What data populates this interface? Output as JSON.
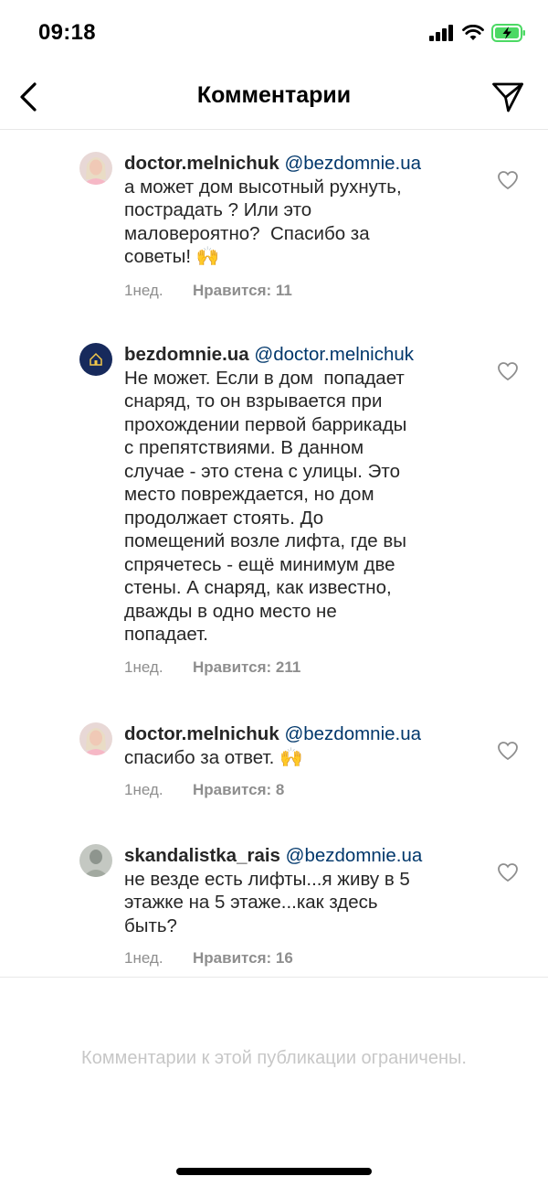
{
  "status_bar": {
    "time": "09:18"
  },
  "header": {
    "title": "Комментарии"
  },
  "comments": [
    {
      "username": "doctor.melnichuk",
      "mention": "@bezdomnie.ua",
      "text": "а может дом высотный рухнуть,\nпострадать ? Или это\nмаловероятно?  Спасибо за\nсоветы! 🙌",
      "time": "1нед.",
      "likes": "Нравится: 11",
      "avatar_icon": "woman-portrait-avatar"
    },
    {
      "username": "bezdomnie.ua",
      "mention": "@doctor.melnichuk",
      "text": "Не может. Если в дом  попадает\nснаряд, то он взрывается при\nпрохождении первой баррикады\nс препятствиями. В данном\nслучае - это стена с улицы. Это\nместо повреждается, но дом\nпродолжает стоять. До\nпомещений возле лифта, где вы\nспрячетесь - ещё минимум две\nстены. А снаряд, как известно,\nдважды в одно место не\nпопадает.",
      "time": "1нед.",
      "likes": "Нравится: 211",
      "avatar_icon": "bezdomnie-logo-avatar",
      "avatar_text": "bezdomnie.ua"
    },
    {
      "username": "doctor.melnichuk",
      "mention": "@bezdomnie.ua",
      "text": "спасибо за ответ. 🙌",
      "time": "1нед.",
      "likes": "Нравится: 8",
      "avatar_icon": "woman-portrait-avatar"
    },
    {
      "username": "skandalistka_rais",
      "mention": "@bezdomnie.ua",
      "text": "не везде есть лифты...я живу в 5\nэтажке на 5 этаже...как здесь\nбыть?",
      "time": "1нед.",
      "likes": "Нравится: 16",
      "avatar_icon": "person-photo-avatar"
    }
  ],
  "footer": {
    "restricted_notice": "Комментарии к этой публикации ограничены."
  },
  "colors": {
    "mention": "#00376b",
    "meta": "#8e8e8e",
    "battery": "#4cd964",
    "notice": "#c7c7c7"
  }
}
